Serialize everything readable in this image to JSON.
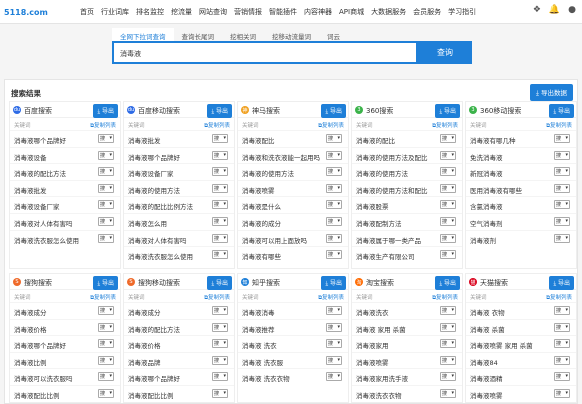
{
  "logo": {
    "main": "5118",
    "suffix": ".com"
  },
  "nav": [
    "首页",
    "行业词库",
    "排名监控",
    "挖流量",
    "网站查询",
    "营销情报",
    "智能插件",
    "内容神器",
    "API商城",
    "大数据服务",
    "会员服务",
    "学习指引"
  ],
  "search": {
    "tabs": [
      "全网下拉词查询",
      "查询长尾词",
      "挖相关词",
      "挖移动流量词",
      "词云"
    ],
    "value": "消毒液",
    "button": "查询"
  },
  "results": {
    "title": "搜索结果",
    "export_all": "导出数据",
    "export": "导出",
    "col_kw": "关键词",
    "col_copy": "复制列表",
    "sel": "搜"
  },
  "blocks": [
    {
      "name": "百度搜索",
      "color": "#2e6be6",
      "glyph": "du",
      "rows": [
        "消毒液哪个品牌好",
        "消毒液设备",
        "消毒液的配比方法",
        "消毒液批发",
        "消毒液设备厂家",
        "消毒液对人体有害吗",
        "消毒液洗衣服怎么使用"
      ]
    },
    {
      "name": "百度移动搜索",
      "color": "#2e6be6",
      "glyph": "du",
      "rows": [
        "消毒液批发",
        "消毒液哪个品牌好",
        "消毒液设备厂家",
        "消毒液的使用方法",
        "消毒液的配比比例方法",
        "消毒液怎么用",
        "消毒液对人体有害吗",
        "消毒液洗衣服怎么使用"
      ]
    },
    {
      "name": "神马搜索",
      "color": "#f0a020",
      "glyph": "神",
      "rows": [
        "消毒液配比",
        "消毒液和洗衣液能一起用吗",
        "消毒液的使用方法",
        "消毒液喷雾",
        "消毒液是什么",
        "消毒液的成分",
        "消毒液可以用上面放吗",
        "消毒液有哪些"
      ]
    },
    {
      "name": "360搜索",
      "color": "#3bb34a",
      "glyph": "3",
      "rows": [
        "消毒液的配比",
        "消毒液的使用方法及配比",
        "消毒液的使用方法",
        "消毒液的使用方法和配比",
        "消毒液股票",
        "消毒液配制方法",
        "消毒液属于哪一类产品",
        "消毒液生产有限公司"
      ]
    },
    {
      "name": "360移动搜索",
      "color": "#3bb34a",
      "glyph": "3",
      "rows": [
        "消毒液有哪几种",
        "免洗消毒液",
        "新冠消毒液",
        "医用消毒液有哪些",
        "含氯消毒液",
        "空气消毒剂",
        "消毒液剂"
      ]
    },
    {
      "name": "搜狗搜索",
      "color": "#ef6a2a",
      "glyph": "S",
      "rows": [
        "消毒液成分",
        "消毒液价格",
        "消毒液哪个品牌好",
        "消毒液比例",
        "消毒液可以洗衣服吗",
        "消毒液配比比例"
      ]
    },
    {
      "name": "搜狗移动搜索",
      "color": "#ef6a2a",
      "glyph": "S",
      "rows": [
        "消毒液成分",
        "消毒液的配比方法",
        "消毒液价格",
        "消毒液品牌",
        "消毒液哪个品牌好",
        "消毒液配比比例"
      ]
    },
    {
      "name": "知乎搜索",
      "color": "#1e7fd8",
      "glyph": "知",
      "rows": [
        "消毒液消毒",
        "消毒液推荐",
        "消毒液 洗衣",
        "消毒液 洗衣服",
        "消毒液 洗衣衣物"
      ]
    },
    {
      "name": "淘宝搜索",
      "color": "#ff6a00",
      "glyph": "淘",
      "rows": [
        "消毒液洗衣",
        "消毒液 家用 杀菌",
        "消毒液家用",
        "消毒液喷雾",
        "消毒液家用洗手液",
        "消毒液洗衣衣物"
      ]
    },
    {
      "name": "天猫搜索",
      "color": "#d9001b",
      "glyph": "猫",
      "rows": [
        "消毒液 衣物",
        "消毒液 杀菌",
        "消毒液喷雾 家用 杀菌",
        "消毒液84",
        "消毒液酒精",
        "消毒液喷雾"
      ]
    }
  ]
}
